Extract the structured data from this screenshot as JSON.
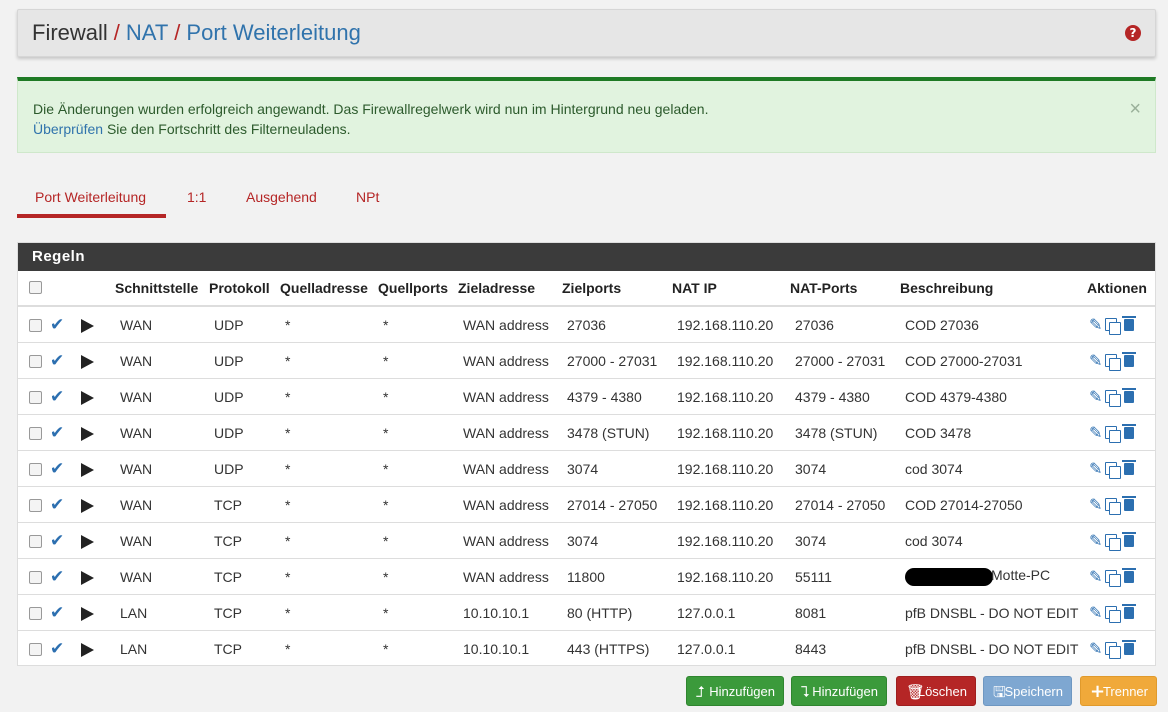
{
  "breadcrumb": {
    "root": "Firewall",
    "nat": "NAT",
    "page": "Port Weiterleitung"
  },
  "help_icon": "question-circle-icon",
  "alert": {
    "line1": "Die Änderungen wurden erfolgreich angewandt. Das Firewallregelwerk wird nun im Hintergrund neu geladen.",
    "line2_link": "Überprüfen",
    "line2_rest": "Sie den Fortschritt des Filterneuladens.",
    "close": "×"
  },
  "tabs": [
    {
      "label": "Port Weiterleitung",
      "active": true
    },
    {
      "label": "1:1",
      "active": false
    },
    {
      "label": "Ausgehend",
      "active": false
    },
    {
      "label": "NPt",
      "active": false
    }
  ],
  "panel_title": "Regeln",
  "columns": [
    "Schnittstelle",
    "Protokoll",
    "Quelladresse",
    "Quellports",
    "Zieladresse",
    "Zielports",
    "NAT IP",
    "NAT-Ports",
    "Beschreibung",
    "Aktionen"
  ],
  "rows": [
    {
      "iface": "WAN",
      "proto": "UDP",
      "src": "*",
      "sport": "*",
      "dst": "WAN address",
      "dport": "27036",
      "natip": "192.168.110.20",
      "natport": "27036",
      "desc": "COD 27036"
    },
    {
      "iface": "WAN",
      "proto": "UDP",
      "src": "*",
      "sport": "*",
      "dst": "WAN address",
      "dport": "27000 - 27031",
      "natip": "192.168.110.20",
      "natport": "27000 - 27031",
      "desc": "COD 27000-27031"
    },
    {
      "iface": "WAN",
      "proto": "UDP",
      "src": "*",
      "sport": "*",
      "dst": "WAN address",
      "dport": "4379 - 4380",
      "natip": "192.168.110.20",
      "natport": "4379 - 4380",
      "desc": "COD 4379-4380"
    },
    {
      "iface": "WAN",
      "proto": "UDP",
      "src": "*",
      "sport": "*",
      "dst": "WAN address",
      "dport": "3478 (STUN)",
      "natip": "192.168.110.20",
      "natport": "3478 (STUN)",
      "desc": "COD 3478"
    },
    {
      "iface": "WAN",
      "proto": "UDP",
      "src": "*",
      "sport": "*",
      "dst": "WAN address",
      "dport": "3074",
      "natip": "192.168.110.20",
      "natport": "3074",
      "desc": "cod 3074"
    },
    {
      "iface": "WAN",
      "proto": "TCP",
      "src": "*",
      "sport": "*",
      "dst": "WAN address",
      "dport": "27014 - 27050",
      "natip": "192.168.110.20",
      "natport": "27014 - 27050",
      "desc": "COD 27014-27050"
    },
    {
      "iface": "WAN",
      "proto": "TCP",
      "src": "*",
      "sport": "*",
      "dst": "WAN address",
      "dport": "3074",
      "natip": "192.168.110.20",
      "natport": "3074",
      "desc": "cod 3074"
    },
    {
      "iface": "WAN",
      "proto": "TCP",
      "src": "*",
      "sport": "*",
      "dst": "WAN address",
      "dport": "11800",
      "natip": "192.168.110.20",
      "natport": "55111",
      "desc": "Motte-PC",
      "redacted": true
    },
    {
      "iface": "LAN",
      "proto": "TCP",
      "src": "*",
      "sport": "*",
      "dst": "10.10.10.1",
      "dport": "80 (HTTP)",
      "natip": "127.0.0.1",
      "natport": "8081",
      "desc": "pfB DNSBL - DO NOT EDIT"
    },
    {
      "iface": "LAN",
      "proto": "TCP",
      "src": "*",
      "sport": "*",
      "dst": "10.10.10.1",
      "dport": "443 (HTTPS)",
      "natip": "127.0.0.1",
      "natport": "8443",
      "desc": "pfB DNSBL - DO NOT EDIT"
    }
  ],
  "row_icons": {
    "status": "check-icon",
    "play": "play-icon",
    "edit": "pencil-icon",
    "copy": "copy-icon",
    "delete": "trash-icon"
  },
  "buttons": {
    "add_top": "Hinzufügen",
    "add_bottom": "Hinzufügen",
    "delete": "Löschen",
    "save": "Speichern",
    "separator": "Trenner"
  },
  "colors": {
    "accent_red": "#b52626",
    "link_blue": "#3073ac",
    "success_green": "#1f7a25",
    "panel_dark": "#3b3b3b"
  }
}
